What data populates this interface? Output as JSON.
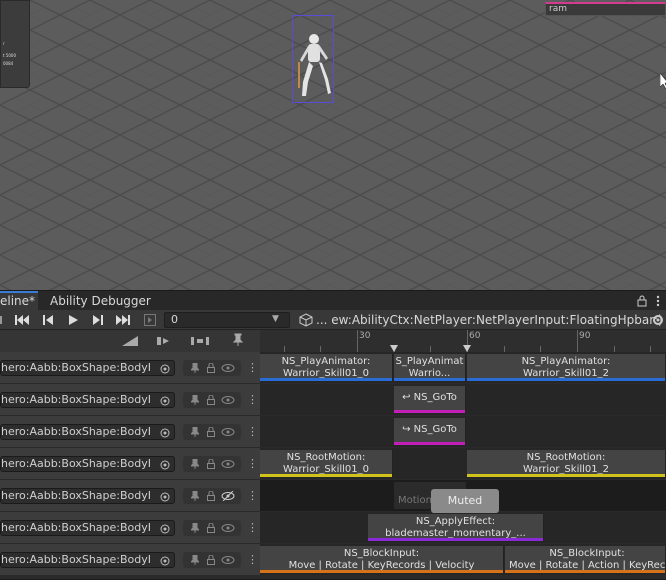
{
  "scene": {
    "ram_label": "ram",
    "overlay_lines": [
      "r",
      "",
      "t 5000",
      "0084"
    ]
  },
  "tabs": {
    "timeline": "eline*",
    "debugger": "Ability Debugger"
  },
  "toolbar": {
    "frame_value": "0",
    "binding": "... ew:AbilityCtx:NetPlayer:NetPlayerInput:FloatingHpbar:)"
  },
  "ruler": {
    "labels": [
      "30",
      "60",
      "90"
    ]
  },
  "tracks": [
    {
      "name": "hero:Aabb:BoxShape:BodyI",
      "clips": [
        {
          "line1": "NS_PlayAnimator:",
          "line2": "Warrior_Skill01_0",
          "bar": "#2a6cd6"
        },
        {
          "line1": "S_PlayAnimat",
          "line2": "Warrio...",
          "bar": "#2a6cd6"
        },
        {
          "line1": "NS_PlayAnimator:",
          "line2": "Warrior_Skill01_2",
          "bar": "#2a6cd6"
        }
      ]
    },
    {
      "name": "hero:Aabb:BoxShape:BodyI",
      "clips": [
        {
          "line1": "NS_GoTo",
          "line2": "",
          "bar": "#c21fb8"
        }
      ]
    },
    {
      "name": "hero:Aabb:BoxShape:BodyI",
      "clips": [
        {
          "line1": "NS_GoTo",
          "line2": "",
          "bar": "#c21fb8"
        }
      ]
    },
    {
      "name": "hero:Aabb:BoxShape:BodyI",
      "clips": [
        {
          "line1": "NS_RootMotion:",
          "line2": "Warrior_Skill01_0",
          "bar": "#cfc21a"
        },
        {
          "line1": "NS_RootMotion:",
          "line2": "Warrior_Skill01_2",
          "bar": "#cfc21a"
        }
      ]
    },
    {
      "name": "hero:Aabb:BoxShape:BodyI",
      "muted_label": "Muted",
      "motion_label": "Motion",
      "clips": []
    },
    {
      "name": "hero:Aabb:BoxShape:BodyI",
      "clips": [
        {
          "line1": "NS_ApplyEffect:",
          "line2": "blademaster_momentary_...",
          "bar": "#8a2ad6"
        }
      ]
    },
    {
      "name": "hero:Aabb:BoxShape:BodyI",
      "clips": [
        {
          "line1": "NS_BlockInput:",
          "line2": "Move | Rotate | KeyRecords | Velocity",
          "bar": "#d6721a"
        },
        {
          "line1": "NS_BlockInput:",
          "line2": "Move | Rotate | Action | KeyRecords",
          "bar": "#d6721a"
        }
      ]
    }
  ],
  "colors": {
    "timeline_accent": "#3a7bd5",
    "bbox": "#5a4cd6",
    "ram_bar": "#d43a8f"
  }
}
